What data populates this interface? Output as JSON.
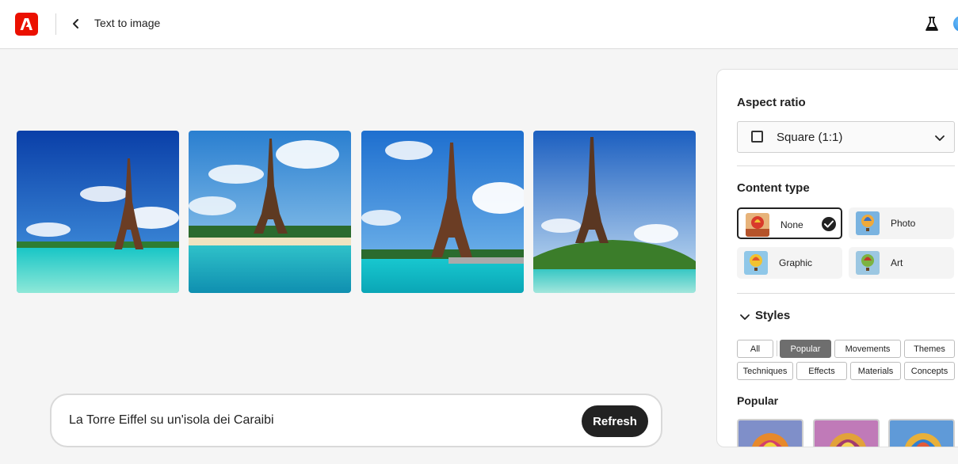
{
  "header": {
    "title": "Text to image",
    "logo_icon": "adobe-logo-icon",
    "back_icon": "chevron-left-icon",
    "labs_icon": "beaker-icon"
  },
  "gallery": {
    "images": [
      {
        "alt": "eiffel-tower-beach-1"
      },
      {
        "alt": "eiffel-tower-beach-2"
      },
      {
        "alt": "eiffel-tower-beach-3"
      },
      {
        "alt": "eiffel-tower-beach-4"
      }
    ]
  },
  "prompt": {
    "text": "La Torre Eiffel su un'isola dei Caraibi",
    "refresh_label": "Refresh"
  },
  "panel": {
    "aspect_ratio": {
      "title": "Aspect ratio",
      "selected": "Square (1:1)"
    },
    "content_type": {
      "title": "Content type",
      "options": [
        {
          "label": "None",
          "selected": true
        },
        {
          "label": "Photo",
          "selected": false
        },
        {
          "label": "Graphic",
          "selected": false
        },
        {
          "label": "Art",
          "selected": false
        }
      ]
    },
    "styles": {
      "title": "Styles",
      "chips": [
        {
          "label": "All",
          "active": false
        },
        {
          "label": "Popular",
          "active": true
        },
        {
          "label": "Movements",
          "active": false
        },
        {
          "label": "Themes",
          "active": false
        },
        {
          "label": "Techniques",
          "active": false
        },
        {
          "label": "Effects",
          "active": false
        },
        {
          "label": "Materials",
          "active": false
        },
        {
          "label": "Concepts",
          "active": false
        }
      ]
    },
    "popular": {
      "title": "Popular"
    }
  },
  "colors": {
    "brand": "#eb1000",
    "active_chip": "#6e6e6e",
    "button_dark": "#222222"
  }
}
